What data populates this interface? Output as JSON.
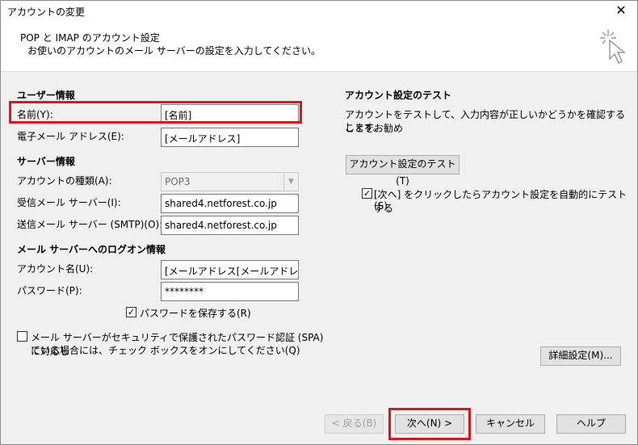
{
  "window": {
    "title": "アカウントの変更",
    "close_glyph": "✕"
  },
  "header": {
    "title": "POP と IMAP のアカウント設定",
    "subtitle": "お使いのアカウントのメール サーバーの設定を入力してください。"
  },
  "user_info": {
    "heading": "ユーザー情報",
    "name_label": "名前(Y):",
    "name_value": "[名前]",
    "email_label": "電子メール アドレス(E):",
    "email_value": "[メールアドレス]"
  },
  "server_info": {
    "heading": "サーバー情報",
    "account_type_label": "アカウントの種類(A):",
    "account_type_value": "POP3",
    "incoming_label": "受信メール サーバー(I):",
    "incoming_value": "shared4.netforest.co.jp",
    "outgoing_label": "送信メール サーバー (SMTP)(O):",
    "outgoing_value": "shared4.netforest.co.jp"
  },
  "logon_info": {
    "heading": "メール サーバーへのログオン情報",
    "account_name_label": "アカウント名(U):",
    "account_name_value": "[メールアドレス[メールアドレス]]",
    "password_label": "パスワード(P):",
    "password_value": "********",
    "save_password_label": "パスワードを保存する(R)",
    "save_password_checked": true,
    "spa_label_line1": "メール サーバーがセキュリティで保護されたパスワード認証 (SPA) に対応し",
    "spa_label_line2": "ている場合には、チェック ボックスをオンにしてください(Q)",
    "spa_checked": false
  },
  "test_settings": {
    "heading": "アカウント設定のテスト",
    "description_line1": "アカウントをテストして、入力内容が正しいかどうかを確認することをお勧め",
    "description_line2": "します。",
    "test_button": "アカウント設定のテスト(T)",
    "auto_test_label_line1": "[次へ] をクリックしたらアカウント設定を自動的にテストする",
    "auto_test_label_line2": "(S)",
    "auto_test_checked": true,
    "advanced_button": "詳細設定(M)..."
  },
  "footer": {
    "back_button": "< 戻る(B)",
    "next_button": "次へ(N) >",
    "cancel_button": "キャンセル",
    "help_button": "ヘルプ"
  },
  "colors": {
    "highlight": "#e0141e",
    "window_bg": "#f0f0f0",
    "header_bg": "#ffffff"
  },
  "checkmark": "✓"
}
